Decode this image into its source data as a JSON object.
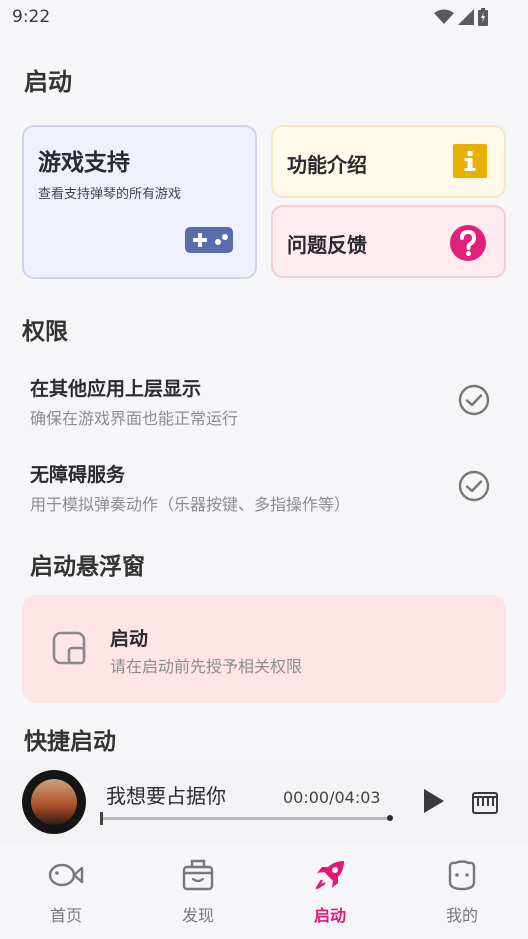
{
  "status_bar": {
    "time": "9:22"
  },
  "page_title": "启动",
  "cards": {
    "games": {
      "title": "游戏支持",
      "subtitle": "查看支持弹琴的所有游戏",
      "icon": "gamepad-icon"
    },
    "intro": {
      "title": "功能介绍",
      "icon": "info-icon"
    },
    "feedback": {
      "title": "问题反馈",
      "icon": "question-icon"
    }
  },
  "permissions": {
    "heading": "权限",
    "items": [
      {
        "title": "在其他应用上层显示",
        "desc": "确保在游戏界面也能正常运行",
        "icon": "check-circle-icon"
      },
      {
        "title": "无障碍服务",
        "desc": "用于模拟弹奏动作（乐器按键、多指操作等）",
        "icon": "check-circle-icon"
      }
    ]
  },
  "floating": {
    "heading": "启动悬浮窗",
    "title": "启动",
    "desc": "请在启动前先授予相关权限",
    "icon": "floating-window-icon"
  },
  "quick": {
    "heading": "快捷启动"
  },
  "player": {
    "song": "我想要占据你",
    "time": "00:00/04:03",
    "progress": 0
  },
  "nav": {
    "items": [
      {
        "label": "首页",
        "icon": "fish-icon",
        "active": false
      },
      {
        "label": "发现",
        "icon": "gift-box-icon",
        "active": false
      },
      {
        "label": "启动",
        "icon": "rocket-icon",
        "active": true
      },
      {
        "label": "我的",
        "icon": "face-icon",
        "active": false
      }
    ]
  },
  "colors": {
    "accent": "#e3177a",
    "info": "#e8b000",
    "question": "#e21f7a",
    "gamepad": "#5a6cab"
  }
}
